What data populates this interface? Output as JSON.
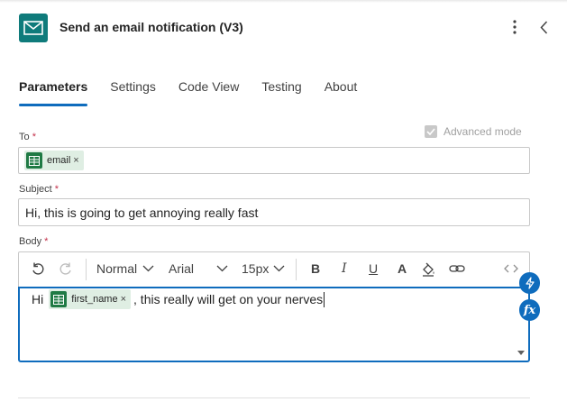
{
  "header": {
    "title": "Send an email notification (V3)",
    "app_icon": "mail-icon",
    "accent": "#0f7b7b",
    "more_icon": "more-vertical-icon",
    "collapse_icon": "chevron-left-icon"
  },
  "tabs": [
    {
      "label": "Parameters",
      "active": true
    },
    {
      "label": "Settings",
      "active": false
    },
    {
      "label": "Code View",
      "active": false
    },
    {
      "label": "Testing",
      "active": false
    },
    {
      "label": "About",
      "active": false
    }
  ],
  "advanced_mode": {
    "label": "Advanced mode",
    "checked": true,
    "disabled": true
  },
  "fields": {
    "to": {
      "label": "To",
      "required_mark": "*",
      "tokens": [
        {
          "label": "email",
          "remove": "×",
          "icon": "excel-icon"
        }
      ]
    },
    "subject": {
      "label": "Subject",
      "required_mark": "*",
      "value": "Hi, this is going to get annoying really fast"
    },
    "body": {
      "label": "Body",
      "required_mark": "*",
      "toolbar": {
        "undo_icon": "undo-icon",
        "redo_icon": "redo-icon",
        "style": "Normal",
        "font": "Arial",
        "size": "15px",
        "bold": "B",
        "italic": "I",
        "underline": "U",
        "font_color": "A",
        "highlight_icon": "paint-bucket-icon",
        "link_icon": "link-icon",
        "code_icon": "code-view-icon"
      },
      "content": {
        "before": "Hi",
        "token": {
          "label": "first_name",
          "remove": "×",
          "icon": "excel-icon"
        },
        "after": ", this really will get on your nerves"
      }
    }
  },
  "side_buttons": {
    "dynamic_content_icon": "lightning-icon",
    "expression_label": "fx"
  },
  "colors": {
    "primary": "#0f6cbd",
    "token_bg": "#dfeee3",
    "excel_green": "#1f7a44",
    "required": "#c4314b"
  }
}
